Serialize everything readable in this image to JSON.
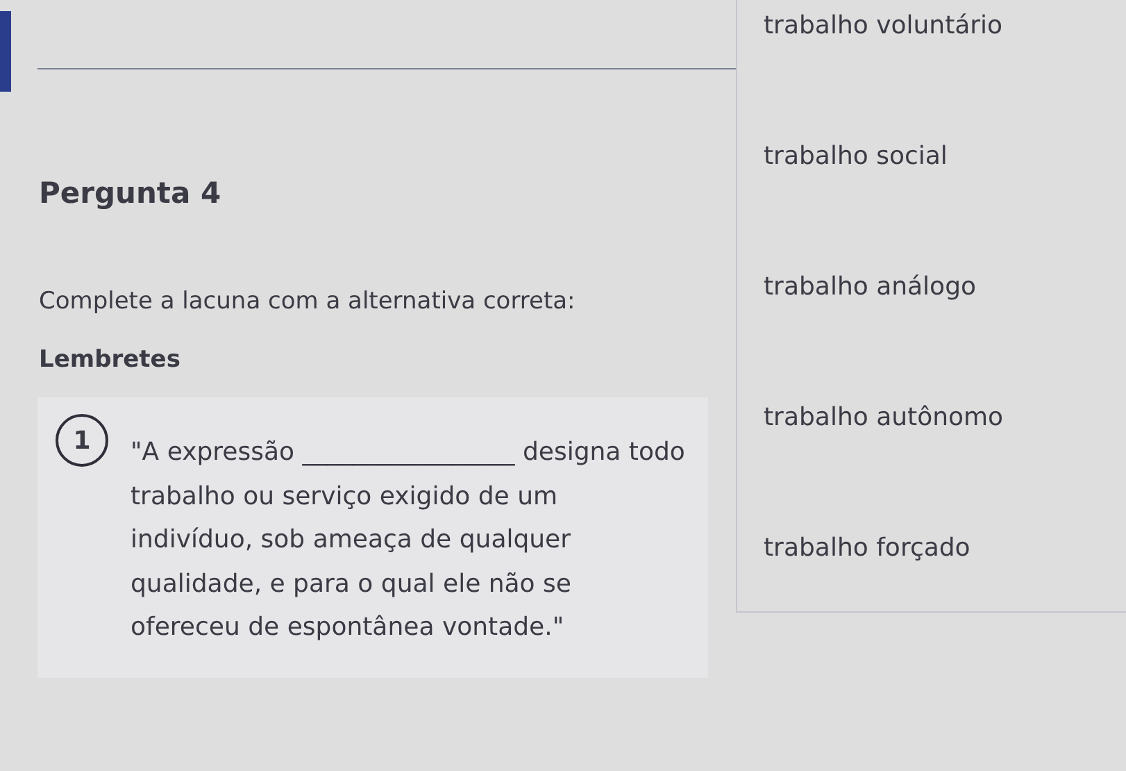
{
  "question": {
    "title": "Pergunta 4",
    "prompt": "Complete a lacuna com a alternativa correta:",
    "reminders_label": "Lembretes"
  },
  "reminders": [
    {
      "number": "1",
      "text": "\"A expressão _________________ designa todo trabalho ou serviço exigido de um indivíduo, sob ameaça de qualquer qualidade, e para o qual ele não se ofereceu de espontânea vontade.\""
    }
  ],
  "options": [
    {
      "label": "trabalho voluntário"
    },
    {
      "label": "trabalho social"
    },
    {
      "label": "trabalho análogo"
    },
    {
      "label": "trabalho autônomo"
    },
    {
      "label": "trabalho forçado"
    }
  ]
}
